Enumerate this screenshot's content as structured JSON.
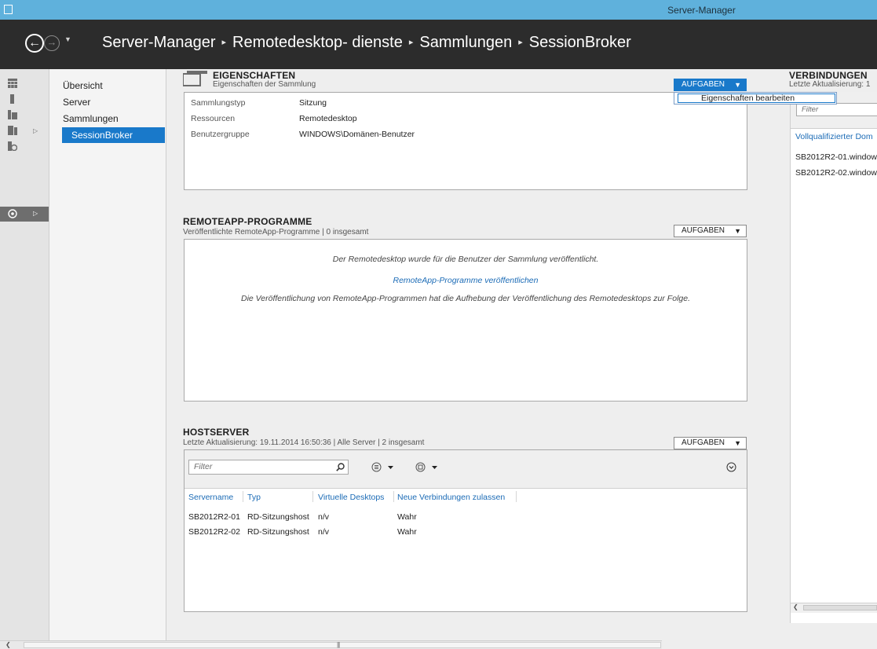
{
  "window": {
    "title": "Server-Manager"
  },
  "breadcrumb": [
    "Server-Manager",
    "Remotedesktop- dienste",
    "Sammlungen",
    "SessionBroker"
  ],
  "nav": {
    "items": [
      "Übersicht",
      "Server",
      "Sammlungen"
    ],
    "selected": "SessionBroker"
  },
  "properties": {
    "title": "EIGENSCHAFTEN",
    "subtitle": "Eigenschaften der Sammlung",
    "tasks_label": "AUFGABEN",
    "dropdown_item": "Eigenschaften bearbeiten",
    "rows": [
      {
        "label": "Sammlungstyp",
        "value": "Sitzung"
      },
      {
        "label": "Ressourcen",
        "value": "Remotedesktop"
      },
      {
        "label": "Benutzergruppe",
        "value": "WINDOWS\\Domänen-Benutzer"
      }
    ]
  },
  "remoteapp": {
    "title": "REMOTEAPP-PROGRAMME",
    "subtitle": "Veröffentlichte RemoteApp-Programme | 0 insgesamt",
    "tasks_label": "AUFGABEN",
    "message": "Der Remotedesktop wurde für die Benutzer der Sammlung veröffentlicht.",
    "link": "RemoteApp-Programme veröffentlichen",
    "note": "Die Veröffentlichung von RemoteApp-Programmen hat die Aufhebung der Veröffentlichung des Remotedesktops zur Folge."
  },
  "hostserver": {
    "title": "HOSTSERVER",
    "subtitle": "Letzte Aktualisierung: 19.11.2014 16:50:36 | Alle Server  | 2 insgesamt",
    "tasks_label": "AUFGABEN",
    "filter_placeholder": "Filter",
    "columns": [
      "Servername",
      "Typ",
      "Virtuelle Desktops",
      "Neue Verbindungen zulassen"
    ],
    "rows": [
      [
        "SB2012R2-01",
        "RD-Sitzungshost",
        "n/v",
        "Wahr"
      ],
      [
        "SB2012R2-02",
        "RD-Sitzungshost",
        "n/v",
        "Wahr"
      ]
    ]
  },
  "connections": {
    "title": "VERBINDUNGEN",
    "subtitle": "Letzte Aktualisierung: 1",
    "filter_placeholder": "Filter",
    "column": "Vollqualifizierter Dom",
    "rows": [
      "SB2012R2-01.window",
      "SB2012R2-02.window"
    ]
  },
  "colors": {
    "accent": "#1979ca",
    "titlebar": "#5fb1dc",
    "header": "#2c2c2c"
  }
}
